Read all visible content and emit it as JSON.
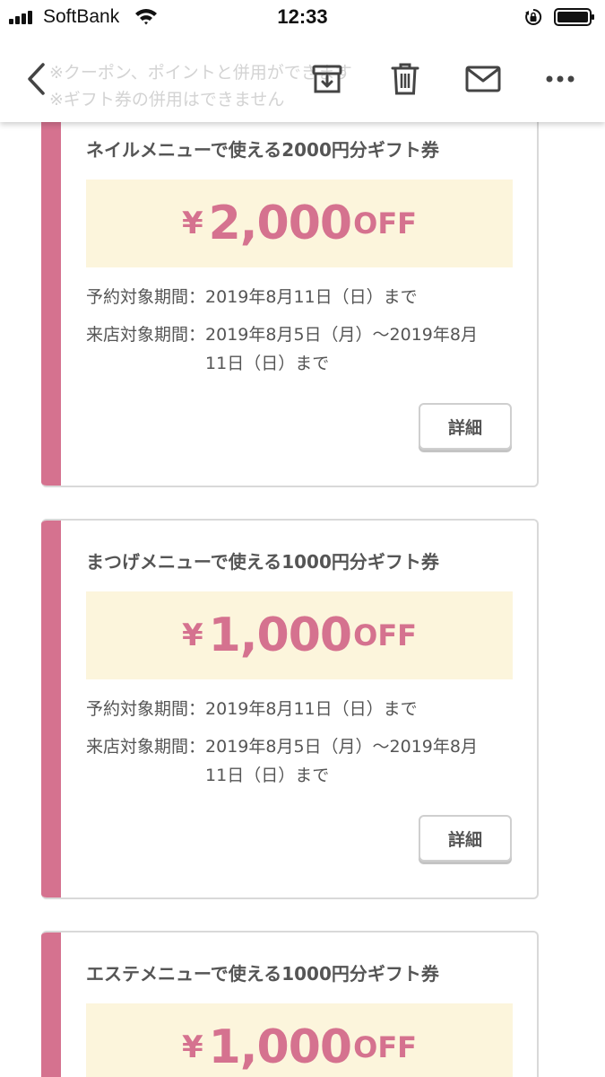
{
  "status_bar": {
    "carrier": "SoftBank",
    "time": "12:33"
  },
  "toolbar": {
    "ghost_line_1": "※クーポン、ポイントと併用ができます",
    "ghost_line_2": "※ギフト券の併用はできません",
    "icons": [
      "back-icon",
      "archive-icon",
      "trash-icon",
      "mail-icon",
      "more-icon"
    ]
  },
  "colors": {
    "accent_pink": "#d5728f",
    "price_bg": "#fcf5dc",
    "border": "#d9d9d9"
  },
  "coupons": [
    {
      "title": "ネイルメニューで使える2000円分ギフト券",
      "yen": "¥",
      "amount": "2,000",
      "off": "OFF",
      "reserve_label": "予約対象期間：",
      "reserve_value": "2019年8月11日（日）まで",
      "visit_label": "来店対象期間：",
      "visit_value": "2019年8月5日（月）〜2019年8月11日（日）まで",
      "button": "詳細"
    },
    {
      "title": "まつげメニューで使える1000円分ギフト券",
      "yen": "¥",
      "amount": "1,000",
      "off": "OFF",
      "reserve_label": "予約対象期間：",
      "reserve_value": "2019年8月11日（日）まで",
      "visit_label": "来店対象期間：",
      "visit_value": "2019年8月5日（月）〜2019年8月11日（日）まで",
      "button": "詳細"
    },
    {
      "title": "エステメニューで使える1000円分ギフト券",
      "yen": "¥",
      "amount": "1,000",
      "off": "OFF"
    }
  ]
}
